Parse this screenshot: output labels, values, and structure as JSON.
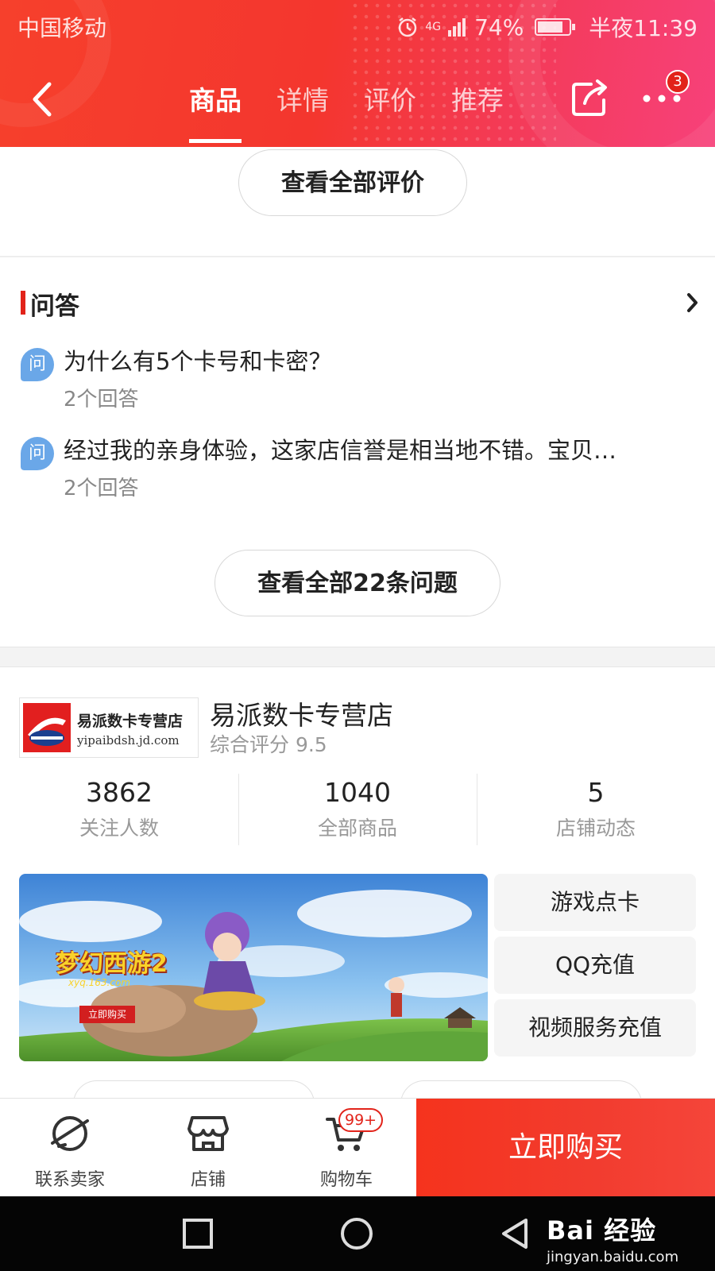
{
  "status_bar": {
    "carrier": "中国移动",
    "network": "4G",
    "battery": "74%",
    "time": "半夜11:39"
  },
  "nav": {
    "tabs": [
      "商品",
      "详情",
      "评价",
      "推荐"
    ],
    "active_tab": "商品",
    "more_badge": "3"
  },
  "reviews": {
    "view_all_label": "查看全部评价"
  },
  "qa": {
    "title": "问答",
    "badge_label": "问",
    "items": [
      {
        "question": "为什么有5个卡号和卡密？",
        "answers": "2个回答"
      },
      {
        "question": "经过我的亲身体验，这家店信誉是相当地不错。宝贝…",
        "answers": "2个回答"
      }
    ],
    "view_all_label": "查看全部22条问题"
  },
  "shop": {
    "logo_name": "易派数卡专营店",
    "logo_url": "yipaibdsh.jd.com",
    "name": "易派数卡专营店",
    "score": "综合评分 9.5",
    "stats": [
      {
        "value": "3862",
        "label": "关注人数"
      },
      {
        "value": "1040",
        "label": "全部商品"
      },
      {
        "value": "5",
        "label": "店铺动态"
      }
    ],
    "banner": {
      "game_logo": "梦幻西游2",
      "game_url": "xyq.163.com",
      "cta": "立即购买"
    },
    "categories": [
      "游戏点卡",
      "QQ充值",
      "视频服务充值"
    ]
  },
  "bottom_bar": {
    "contact_label": "联系卖家",
    "store_label": "店铺",
    "cart_label": "购物车",
    "cart_badge": "99+",
    "buy_label": "立即购买"
  },
  "watermark": {
    "main": "Bai 经验",
    "sub": "jingyan.baidu.com"
  },
  "colors": {
    "brand_red": "#e2231a",
    "header_gradient_start": "#f6402c",
    "header_gradient_end": "#f7417a",
    "qa_badge_blue": "#6aa7e8"
  }
}
